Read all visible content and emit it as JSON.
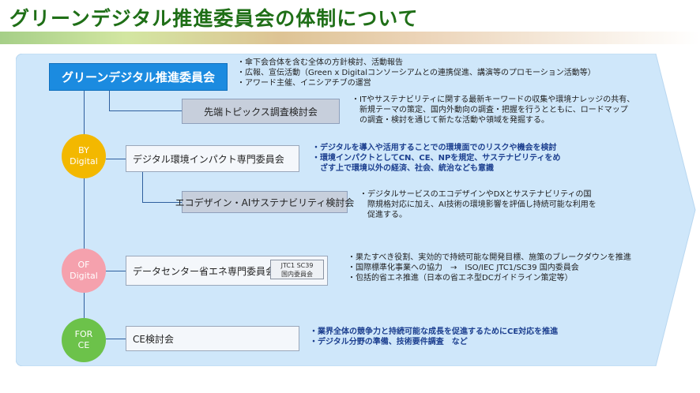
{
  "title": "グリーンデジタル推進委員会の体制について",
  "main_committee": {
    "label": "グリーンデジタル推進委員会",
    "notes": [
      "・傘下会合体を含む全体の方針検討、活動報告",
      "・広報、宣伝活動（Green x Digitalコンソーシアムとの連携促進、講演等のプロモーション活動等）",
      "・アワード主催、イニシアチブの運営"
    ]
  },
  "topics_committee": {
    "label": "先端トピックス調査検討会",
    "notes": [
      "・ITやサステナビリティに関する最新キーワードの収集や環境ナレッジの共有、",
      "　新規テーマの策定、国内外動向の調査・把握を行うとともに、ロードマップ",
      "　の調査・検討を通じて新たな活動や領域を発掘する。"
    ]
  },
  "by_digital": {
    "circle": [
      "BY",
      "Digital"
    ],
    "committee_label": "デジタル環境インパクト専門委員会",
    "notes": [
      "・デジタルを導入や活用することでの環境面でのリスクや機会を検討",
      "・環境インパクトとしてCN、CE、NPを規定、サステナビリティをめ",
      "　ざす上で環境以外の経済、社会、統治なども意識"
    ],
    "sub_label": "エコデザイン・AIサステナビリティ検討会",
    "sub_notes": [
      "・デジタルサービスのエコデザインやDXとサステナビリティの国",
      "　際規格対応に加え、AI技術の環境影響を評価し持続可能な利用を",
      "　促進する。"
    ]
  },
  "of_digital": {
    "circle": [
      "OF",
      "Digital"
    ],
    "committee_label": "データセンター省エネ専門委員会",
    "badge": [
      "JTC1 SC39",
      "国内委員会"
    ],
    "notes": [
      "・果たすべき役割、実効的で持続可能な開発目標、施策のブレークダウンを推進",
      "・国際標準化事業への協力　→　ISO/IEC JTC1/SC39 国内委員会",
      "・包括的省エネ推進（日本の省エネ型DCガイドライン策定等）"
    ]
  },
  "for_ce": {
    "circle": [
      "FOR",
      "CE"
    ],
    "committee_label": "CE検討会",
    "notes": [
      "・業界全体の競争力と持続可能な成長を促進するためにCE対応を推進",
      "・デジタル分野の準備、技術要件調査　など"
    ]
  },
  "colors": {
    "title": "#1f6f17",
    "arrow_fill": "#cfe7fa",
    "main_box": "#1b8be0",
    "by_circle": "#f3b800",
    "of_circle": "#f5a1ad",
    "for_circle": "#6cc24a",
    "connector": "#2f5f9e"
  }
}
